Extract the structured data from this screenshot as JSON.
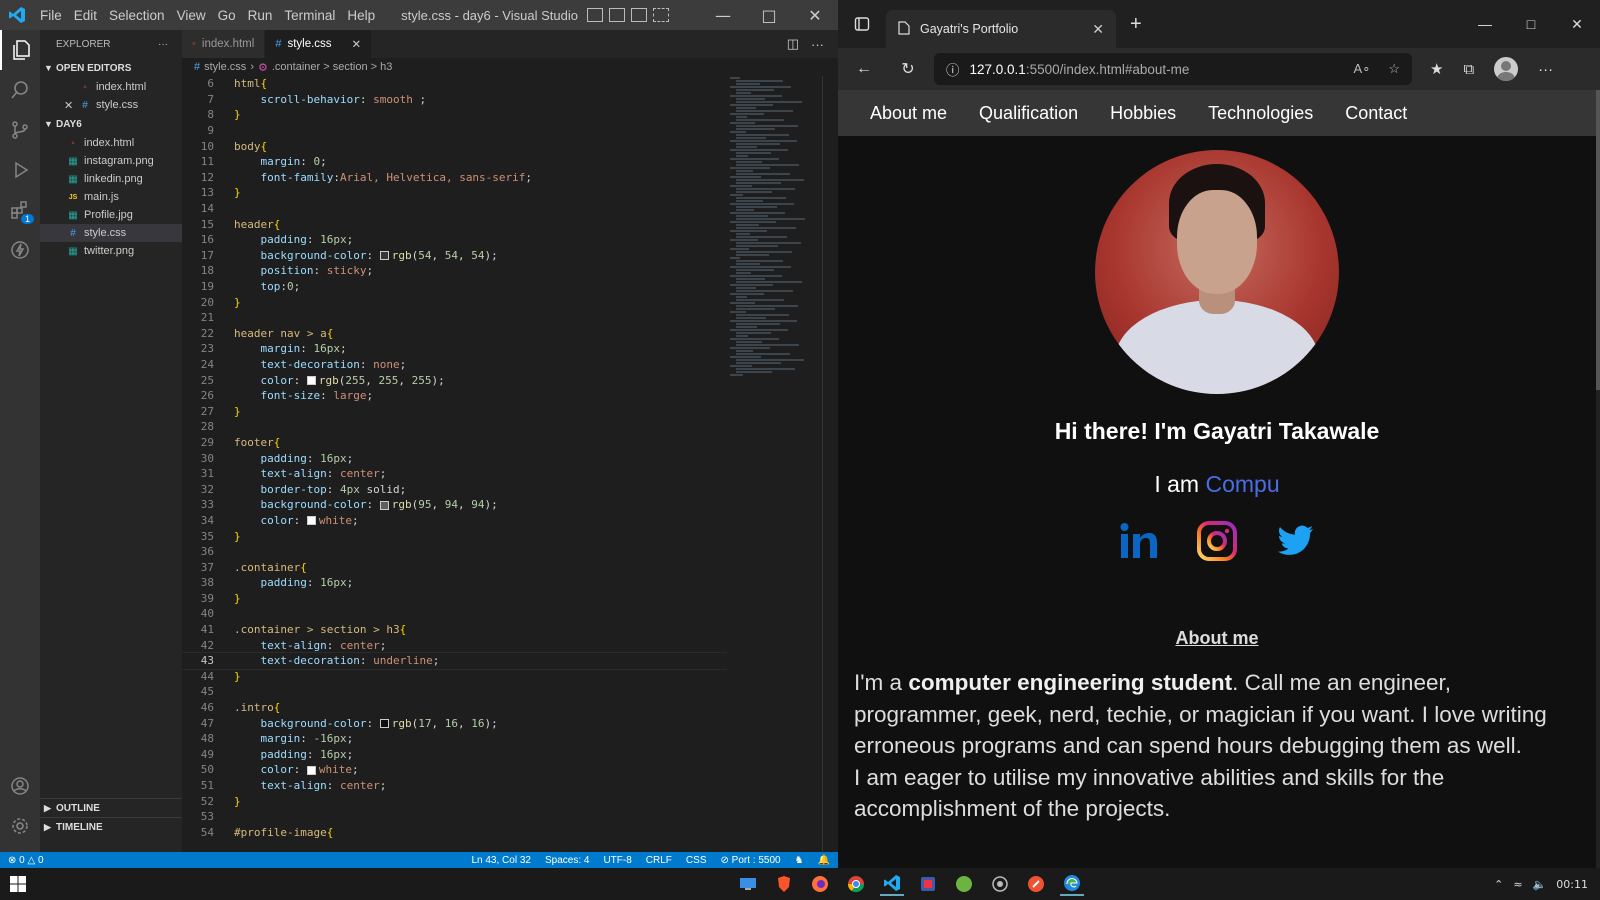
{
  "vscode": {
    "menu": [
      "File",
      "Edit",
      "Selection",
      "View",
      "Go",
      "Run",
      "Terminal",
      "Help"
    ],
    "window_title": "style.css - day6 - Visual Studio C...",
    "explorer_label": "EXPLORER",
    "open_editors_label": "OPEN EDITORS",
    "open_editors": [
      {
        "name": "index.html",
        "icon": "html-file-icon"
      },
      {
        "name": "style.css",
        "icon": "css-file-icon",
        "closable": true
      }
    ],
    "folder_label": "DAY6",
    "files": [
      {
        "name": "index.html",
        "icon": "html-file-icon"
      },
      {
        "name": "instagram.png",
        "icon": "image-file-icon"
      },
      {
        "name": "linkedin.png",
        "icon": "image-file-icon"
      },
      {
        "name": "main.js",
        "icon": "js-file-icon"
      },
      {
        "name": "Profile.jpg",
        "icon": "image-file-icon"
      },
      {
        "name": "style.css",
        "icon": "css-file-icon",
        "selected": true
      },
      {
        "name": "twitter.png",
        "icon": "image-file-icon"
      }
    ],
    "outline_label": "OUTLINE",
    "timeline_label": "TIMELINE",
    "extensions_badge": "1",
    "tabs": [
      {
        "label": "index.html",
        "active": false
      },
      {
        "label": "style.css",
        "active": true
      }
    ],
    "breadcrumbs": [
      "style.css",
      ".container > section > h3"
    ],
    "code_lines": [
      {
        "n": "6",
        "t": "html{"
      },
      {
        "n": "7",
        "t": "    scroll-behavior: smooth ;"
      },
      {
        "n": "8",
        "t": "}"
      },
      {
        "n": "9",
        "t": ""
      },
      {
        "n": "10",
        "t": "body{"
      },
      {
        "n": "11",
        "t": "    margin: 0;"
      },
      {
        "n": "12",
        "t": "    font-family:Arial, Helvetica, sans-serif;"
      },
      {
        "n": "13",
        "t": "}"
      },
      {
        "n": "14",
        "t": ""
      },
      {
        "n": "15",
        "t": "header{"
      },
      {
        "n": "16",
        "t": "    padding: 16px;"
      },
      {
        "n": "17",
        "t": "    background-color: rgb(54, 54, 54);",
        "swatch": "#363636"
      },
      {
        "n": "18",
        "t": "    position: sticky;"
      },
      {
        "n": "19",
        "t": "    top:0;"
      },
      {
        "n": "20",
        "t": "}"
      },
      {
        "n": "21",
        "t": ""
      },
      {
        "n": "22",
        "t": "header nav > a{"
      },
      {
        "n": "23",
        "t": "    margin: 16px;"
      },
      {
        "n": "24",
        "t": "    text-decoration: none;"
      },
      {
        "n": "25",
        "t": "    color: rgb(255, 255, 255);",
        "swatch": "#ffffff"
      },
      {
        "n": "26",
        "t": "    font-size: large;"
      },
      {
        "n": "27",
        "t": "}"
      },
      {
        "n": "28",
        "t": ""
      },
      {
        "n": "29",
        "t": "footer{"
      },
      {
        "n": "30",
        "t": "    padding: 16px;"
      },
      {
        "n": "31",
        "t": "    text-align: center;"
      },
      {
        "n": "32",
        "t": "    border-top: 4px solid;"
      },
      {
        "n": "33",
        "t": "    background-color: rgb(95, 94, 94);",
        "swatch": "#5f5e5e"
      },
      {
        "n": "34",
        "t": "    color: white;",
        "swatch": "#ffffff"
      },
      {
        "n": "35",
        "t": "}"
      },
      {
        "n": "36",
        "t": ""
      },
      {
        "n": "37",
        "t": ".container{"
      },
      {
        "n": "38",
        "t": "    padding: 16px;"
      },
      {
        "n": "39",
        "t": "}"
      },
      {
        "n": "40",
        "t": ""
      },
      {
        "n": "41",
        "t": ".container > section > h3{"
      },
      {
        "n": "42",
        "t": "    text-align: center;"
      },
      {
        "n": "43",
        "t": "    text-decoration: underline;",
        "current": true
      },
      {
        "n": "44",
        "t": "}"
      },
      {
        "n": "45",
        "t": ""
      },
      {
        "n": "46",
        "t": ".intro{"
      },
      {
        "n": "47",
        "t": "    background-color: rgb(17, 16, 16);",
        "swatch": "#111010"
      },
      {
        "n": "48",
        "t": "    margin: -16px;"
      },
      {
        "n": "49",
        "t": "    padding: 16px;"
      },
      {
        "n": "50",
        "t": "    color: white;",
        "swatch": "#ffffff"
      },
      {
        "n": "51",
        "t": "    text-align: center;"
      },
      {
        "n": "52",
        "t": "}"
      },
      {
        "n": "53",
        "t": ""
      },
      {
        "n": "54",
        "t": "#profile-image{"
      }
    ],
    "status": {
      "errors": "0",
      "warnings": "0",
      "position": "Ln 43, Col 32",
      "spaces": "Spaces: 4",
      "encoding": "UTF-8",
      "eol": "CRLF",
      "language": "CSS",
      "port": "Port : 5500"
    },
    "accent_color": "#007acc"
  },
  "browser": {
    "tab_title": "Gayatri's Portfolio",
    "url_host": "127.0.0.1",
    "url_path": ":5500/index.html#about-me",
    "nav": [
      "About me",
      "Qualification",
      "Hobbies",
      "Technologies",
      "Contact"
    ],
    "greeting": "Hi there! I'm Gayatri Takawale",
    "iam_prefix": "I am",
    "iam_typed": "Compu",
    "social": [
      {
        "name": "linkedin-icon",
        "color": "#0a66c2"
      },
      {
        "name": "instagram-icon",
        "color": "#e1306c"
      },
      {
        "name": "twitter-icon",
        "color": "#1da1f2"
      }
    ],
    "about_heading": "About me",
    "about_p1_prefix": "I'm a ",
    "about_p1_bold": "computer engineering student",
    "about_p1_rest": ". Call me an engineer, programmer, geek, nerd, techie, or magician if you want. I love writing erroneous programs and can spend hours debugging them as well.",
    "about_p2": "I am eager to utilise my innovative abilities and skills for the accomplishment of the projects."
  },
  "taskbar": {
    "time": "00:11",
    "apps": [
      "desktop-app-icon",
      "brave-icon",
      "firefox-icon",
      "chrome-icon",
      "vscode-icon",
      "app-icon",
      "spring-icon",
      "app-icon-2",
      "git-icon",
      "edge-icon"
    ]
  }
}
